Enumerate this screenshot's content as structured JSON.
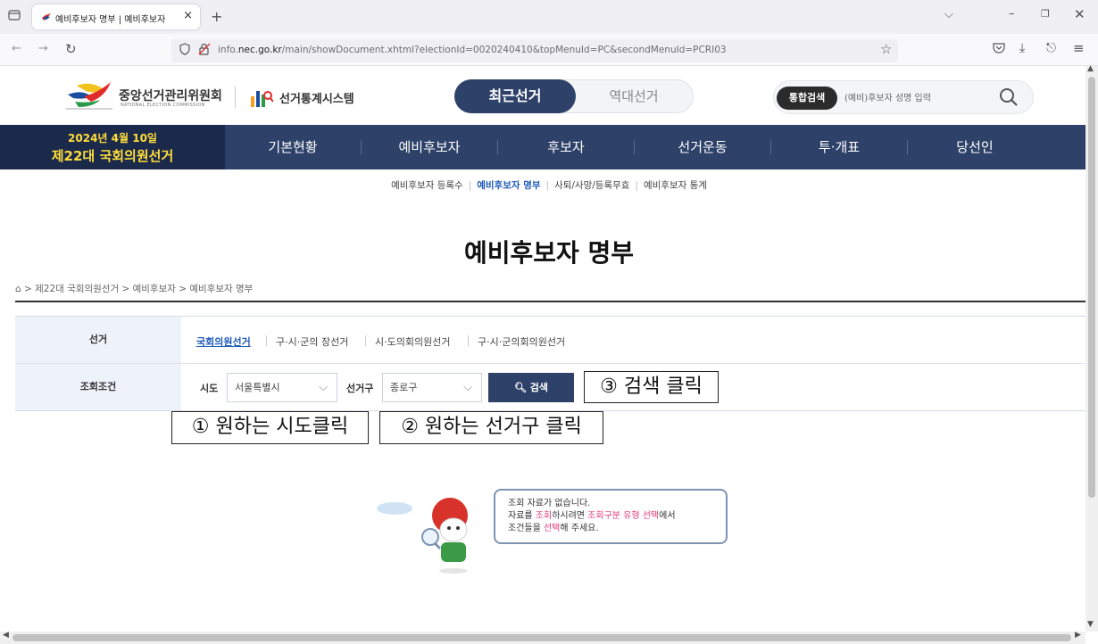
{
  "browser": {
    "tab_title": "예비후보자 명부 | 예비후보자",
    "url_prefix": "info.",
    "url_domain": "nec.go.kr",
    "url_path": "/main/showDocument.xhtml?electionId=0020240410&topMenuId=PC&secondMenuId=PCRI03",
    "icons": [
      "tab-list-icon",
      "favicon",
      "close-icon",
      "new-tab-icon",
      "back-icon",
      "forward-icon",
      "reload-icon",
      "shield-icon",
      "lock-warning-icon",
      "star-icon",
      "pocket-icon",
      "download-icon",
      "share-icon",
      "menu-icon",
      "minimize-icon",
      "restore-icon",
      "window-close-icon",
      "chevron-down-icon"
    ]
  },
  "header": {
    "logo_ko": "중앙선거관리위원회",
    "logo_en": "NATIONAL ELECTION COMMISSION",
    "system_title": "선거통계시스템",
    "toggle_recent": "최근선거",
    "toggle_history": "역대선거",
    "search_badge": "통합검색",
    "search_placeholder": "(예비)후보자 성명 입력"
  },
  "nav": {
    "date_line1": "2024년 4월 10일",
    "date_line2": "제22대 국회의원선거",
    "items": [
      "기본현황",
      "예비후보자",
      "후보자",
      "선거운동",
      "투·개표",
      "당선인"
    ]
  },
  "subnav": {
    "items": [
      "예비후보자 등록수",
      "예비후보자 명부",
      "사퇴/사망/등록무효",
      "예비후보자 통계"
    ],
    "active_index": 1
  },
  "page": {
    "title": "예비후보자 명부",
    "breadcrumb": "> 제22대 국회의원선거 > 예비후보자 > 예비후보자 명부"
  },
  "form": {
    "election_label": "선거",
    "election_types": [
      "국회의원선거",
      "구·시·군의 장선거",
      "시·도의회의원선거",
      "구·시·군의회의원선거"
    ],
    "condition_label": "조회조건",
    "sido_label": "시도",
    "sido_value": "서울특별시",
    "district_label": "선거구",
    "district_value": "종로구",
    "search_button": "검색"
  },
  "callouts": {
    "step1": "① 원하는 시도클릭",
    "step2": "② 원하는 선거구 클릭",
    "step3": "③ 검색 클릭"
  },
  "empty_state": {
    "line1": "조회 자료가 없습니다.",
    "line2_a": "자료를 ",
    "line2_b": "조회",
    "line2_c": "하시려면 ",
    "line2_d": "조회구분 유형 선택",
    "line2_e": "에서",
    "line3_a": "조건들을 ",
    "line3_b": "선택",
    "line3_c": "해 주세요."
  },
  "colors": {
    "nav_bg": "#2d4169",
    "date_bg": "#1b2a4a",
    "date_text": "#ffdd3a",
    "active_link": "#1e5bb8",
    "highlight": "#e23a7a"
  }
}
